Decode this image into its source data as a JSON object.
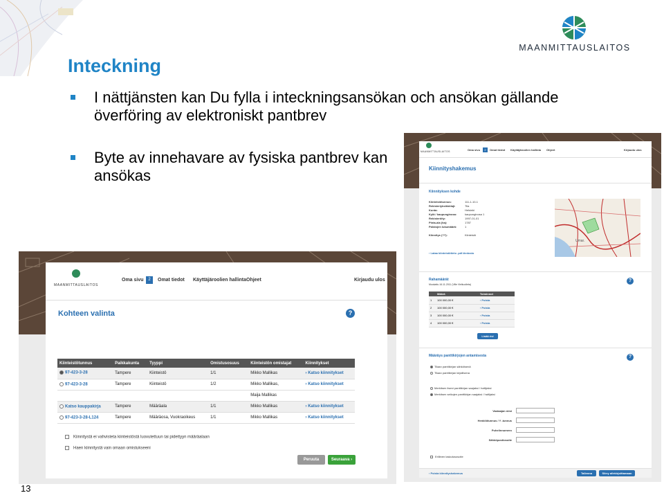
{
  "slide": {
    "title": "Inteckning",
    "bullets": [
      "I nättjänsten kan Du fylla i inteckningsansökan och ansökan gällande överföring av elektroniskt pantbrev",
      "Byte av innehavare av fysiska pantbrev kan ansökas"
    ],
    "page_number": "13"
  },
  "logo": {
    "text": "MAANMITTAUSLAITOS",
    "icon": "maanmittauslaitos-logo-icon"
  },
  "colors": {
    "accent": "#1f84c6",
    "header_brown": "#5b4638",
    "button_green": "#3aa23a",
    "button_blue": "#2a6fb0"
  },
  "screen_left": {
    "nav": {
      "logo_text": "MAANMITTAUSLAITOS",
      "items": [
        "Oma sivu",
        "Omat tiedot",
        "Käyttäjäroolien hallinta",
        "Ohjeet",
        "Kirjaudu ulos"
      ],
      "badge": "2"
    },
    "section_title": "Kohteen valinta",
    "table": {
      "headers": [
        "Kiinteistötunnus",
        "Paikkakunta",
        "Tyyppi",
        "Omistusosuus",
        "Kiinteistön omistajat",
        "Kiinnitykset"
      ],
      "rows": [
        [
          "97-423-3-28",
          "Tampere",
          "Kiinteistö",
          "1/1",
          "Mikko Mallikas",
          "› Katso kiinnitykset"
        ],
        [
          "97-423-3-28",
          "Tampere",
          "Kiinteistö",
          "1/2",
          "Mikko Mallikas,",
          "› Katso kiinnitykset"
        ],
        [
          "",
          "",
          "",
          "",
          "Maija Mallikas",
          ""
        ],
        [
          "Katso kauppakirja",
          "Tampere",
          "Määräala",
          "1/1",
          "Mikko Mallikas",
          "› Katso kiinnitykset"
        ],
        [
          "97-423-3-28-L124",
          "Tampere",
          "Määräosa, Vuokraoikeus",
          "1/1",
          "Mikko Mallikas",
          "› Katso kiinnitykset"
        ]
      ]
    },
    "checkboxes": [
      "Kiinnitystä ei vahvisteta kiinteistöstä luovutettuun tai pidettyyn määräalaan",
      "Haen kiinnitystä vain omaan omistukseeni"
    ],
    "buttons": {
      "back": "Peruuta",
      "next": "Seuraava ›"
    }
  },
  "screen_right": {
    "nav": {
      "logo_text": "MAANMITTAUSLAITOS",
      "items": [
        "Oma sivu",
        "Omat tiedot",
        "Käyttäjäroolien hallinta",
        "Ohjeet",
        "Kirjaudu ulos"
      ],
      "badge": "2"
    },
    "page_title": "Kiinnityshakemus",
    "target": {
      "title": "Kiinnityksen kohde",
      "labels": [
        "Kiinteistötunnus:",
        "Rekisteriyksikkölaji:",
        "Kunta:",
        "Kylä / kaupunginosa:",
        "Rekisteröity:",
        "Pinta-ala (ha):",
        "Palstojen lukumäärä:",
        "Kiinnitys (??):"
      ],
      "values": [
        "111-1-10-1",
        "Tila",
        "Helsinki",
        "kaupunginosa 1",
        "1997-01-01",
        "1787",
        "1",
        "Kiinteistö"
      ],
      "link": "› Lataa kiinteistötieto .pdf-tiedosto",
      "map_label": "Umar."
    },
    "amounts": {
      "title": "Rahamäärät",
      "subtitle": "Muokattu 16.11.2011 (Ville Vielkuolleta)",
      "headers": [
        "Määrä",
        "Toiminnot"
      ],
      "rows": [
        [
          "1",
          "100 000,00 €",
          "› Poista"
        ],
        [
          "2",
          "100 000,00 €",
          "› Poista"
        ],
        [
          "3",
          "100 000,00 €",
          "› Poista"
        ],
        [
          "4",
          "100 000,00 €",
          "› Poista"
        ]
      ],
      "add_button": "Lisää rivi"
    },
    "pledge": {
      "title": "Määräys panttikirjojen antamisesta",
      "radios_a": [
        "Tilaan panttikirjan sähköisenä",
        "Tilaan panttikirjan kirjallisena"
      ],
      "radios_b": [
        "Merkitsen itseni panttikirjan saajaksi / haltijaksi",
        "Merkitsen seikojen panttikirjan saajaksi / haltijaksi"
      ],
      "fields": [
        "Vastaajan nimi",
        "Henkilötunnus / Y -tunnus",
        "Puhelinnumero",
        "Sähköpostiosoite"
      ],
      "checkbox": "Erillinen laskutusosoite"
    },
    "footer": {
      "link": "› Poista kiinnityshakemus",
      "save": "Tallenna",
      "next": "Siirry allekirjoittamaan"
    }
  }
}
